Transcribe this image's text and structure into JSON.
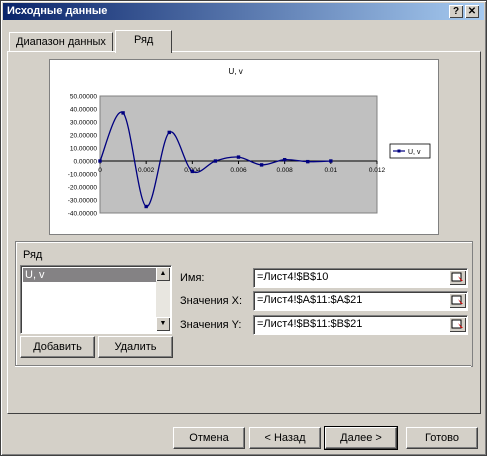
{
  "window": {
    "title": "Исходные данные",
    "help": "?",
    "close": "✕"
  },
  "tabs": [
    "Диапазон данных",
    "Ряд"
  ],
  "chart_data": {
    "type": "line",
    "title": "U, v",
    "legend": "U, v",
    "legend_position": "right",
    "x": [
      0,
      0.001,
      0.002,
      0.003,
      0.004,
      0.005,
      0.006,
      0.007,
      0.008,
      0.009,
      0.01
    ],
    "series": [
      {
        "name": "U, v",
        "values": [
          0,
          37,
          -35,
          22,
          -8,
          0,
          3,
          -3,
          1,
          -0.5,
          0
        ]
      }
    ],
    "x_ticks": [
      "0",
      "0.002",
      "0.004",
      "0.006",
      "0.008",
      "0.01",
      "0.012"
    ],
    "y_ticks": [
      "50.00000",
      "40.00000",
      "30.00000",
      "20.00000",
      "10.00000",
      "0.00000",
      "-10.00000",
      "-20.00000",
      "-30.00000",
      "-40.00000"
    ],
    "xlim": [
      0,
      0.012
    ],
    "ylim": [
      -40,
      50
    ],
    "plot_bg": "#c0c0c0",
    "line_color": "#000080"
  },
  "series_section": {
    "label": "Ряд",
    "items": [
      "U, v"
    ],
    "add": "Добавить",
    "remove": "Удалить"
  },
  "fields": {
    "name_label": "Имя:",
    "name_value": "=Лист4!$B$10",
    "x_label": "Значения X:",
    "x_value": "=Лист4!$A$11:$A$21",
    "y_label": "Значения Y:",
    "y_value": "=Лист4!$B$11:$B$21"
  },
  "footer": {
    "cancel": "Отмена",
    "back": "< Назад",
    "next": "Далее >",
    "finish": "Готово"
  }
}
